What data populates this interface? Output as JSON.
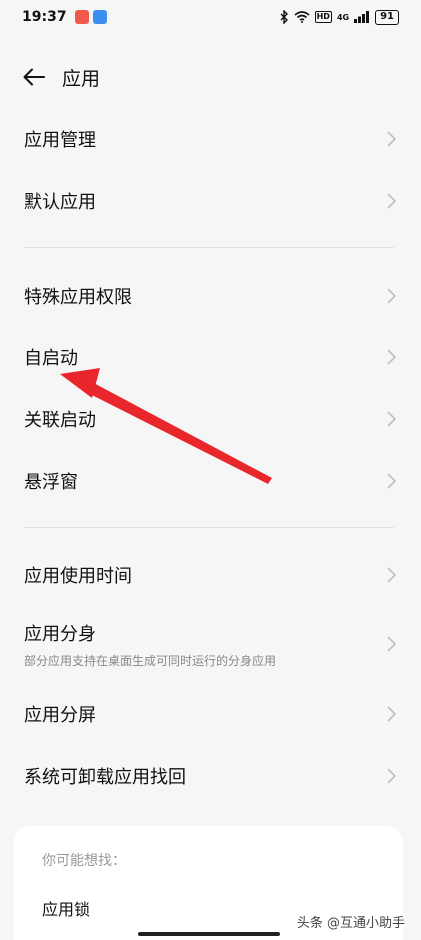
{
  "status_bar": {
    "time": "19:37",
    "network": "4G",
    "hd": "HD",
    "battery": "91",
    "icons": [
      "bluetooth-icon",
      "wifi-icon",
      "signal-icon"
    ]
  },
  "header": {
    "title": "应用",
    "back_icon": "arrow-left-icon"
  },
  "menu": {
    "items": [
      {
        "label": "应用管理"
      },
      {
        "label": "默认应用"
      },
      {
        "label": "特殊应用权限"
      },
      {
        "label": "自启动"
      },
      {
        "label": "关联启动"
      },
      {
        "label": "悬浮窗"
      },
      {
        "label": "应用使用时间"
      },
      {
        "label": "应用分身",
        "subtitle": "部分应用支持在桌面生成可同时运行的分身应用"
      },
      {
        "label": "应用分屏"
      },
      {
        "label": "系统可卸载应用找回"
      }
    ]
  },
  "suggestions": {
    "title": "你可能想找：",
    "items": [
      "应用锁"
    ]
  },
  "watermark": "头条 @互通小助手",
  "colors": {
    "background": "#f6f6f6",
    "annotation_arrow": "#e8262c",
    "chevron": "#bdbdbd"
  }
}
